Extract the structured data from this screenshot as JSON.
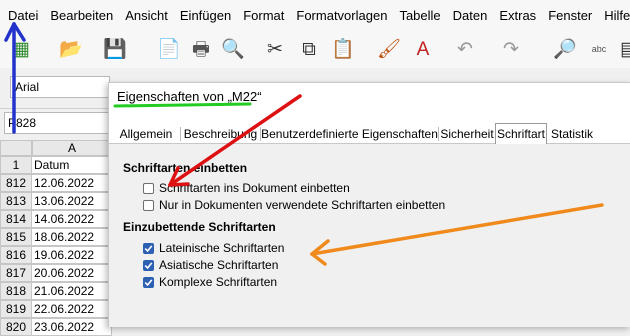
{
  "menubar": {
    "items": [
      "Datei",
      "Bearbeiten",
      "Ansicht",
      "Einfügen",
      "Format",
      "Formatvorlagen",
      "Tabelle",
      "Daten",
      "Extras",
      "Fenster",
      "Hilfe"
    ]
  },
  "formatting": {
    "font_name": "Arial"
  },
  "namebox": {
    "value": "P828"
  },
  "sheet": {
    "column_header": "A",
    "rows": [
      {
        "num": "1",
        "value": "Datum"
      },
      {
        "num": "812",
        "value": "12.06.2022"
      },
      {
        "num": "813",
        "value": "13.06.2022"
      },
      {
        "num": "814",
        "value": "14.06.2022"
      },
      {
        "num": "815",
        "value": "18.06.2022"
      },
      {
        "num": "816",
        "value": "19.06.2022"
      },
      {
        "num": "817",
        "value": "20.06.2022"
      },
      {
        "num": "818",
        "value": "21.06.2022"
      },
      {
        "num": "819",
        "value": "22.06.2022"
      },
      {
        "num": "820",
        "value": "23.06.2022"
      }
    ]
  },
  "dialog": {
    "title": "Eigenschaften von „M22“",
    "tabs": [
      "Allgemein",
      "Beschreibung",
      "Benutzerdefinierte Eigenschaften",
      "Sicherheit",
      "Schriftart",
      "Statistik"
    ],
    "selected_tab": "Schriftart",
    "section1": {
      "heading": "Schriftarten einbetten",
      "options": [
        {
          "label": "Schriftarten ins Dokument einbetten",
          "checked": false
        },
        {
          "label": "Nur in Dokumenten verwendete Schriftarten einbetten",
          "checked": false
        }
      ]
    },
    "section2": {
      "heading": "Einzubettende Schriftarten",
      "options": [
        {
          "label": "Lateinische Schriftarten",
          "checked": true
        },
        {
          "label": "Asiatische Schriftarten",
          "checked": true
        },
        {
          "label": "Komplexe Schriftarten",
          "checked": true
        }
      ]
    }
  },
  "annotation_colors": {
    "blue_arrow": "#2233cc",
    "green_underline": "#22cc22",
    "red_arrow": "#dd1111",
    "orange_arrow": "#f08a1c"
  }
}
